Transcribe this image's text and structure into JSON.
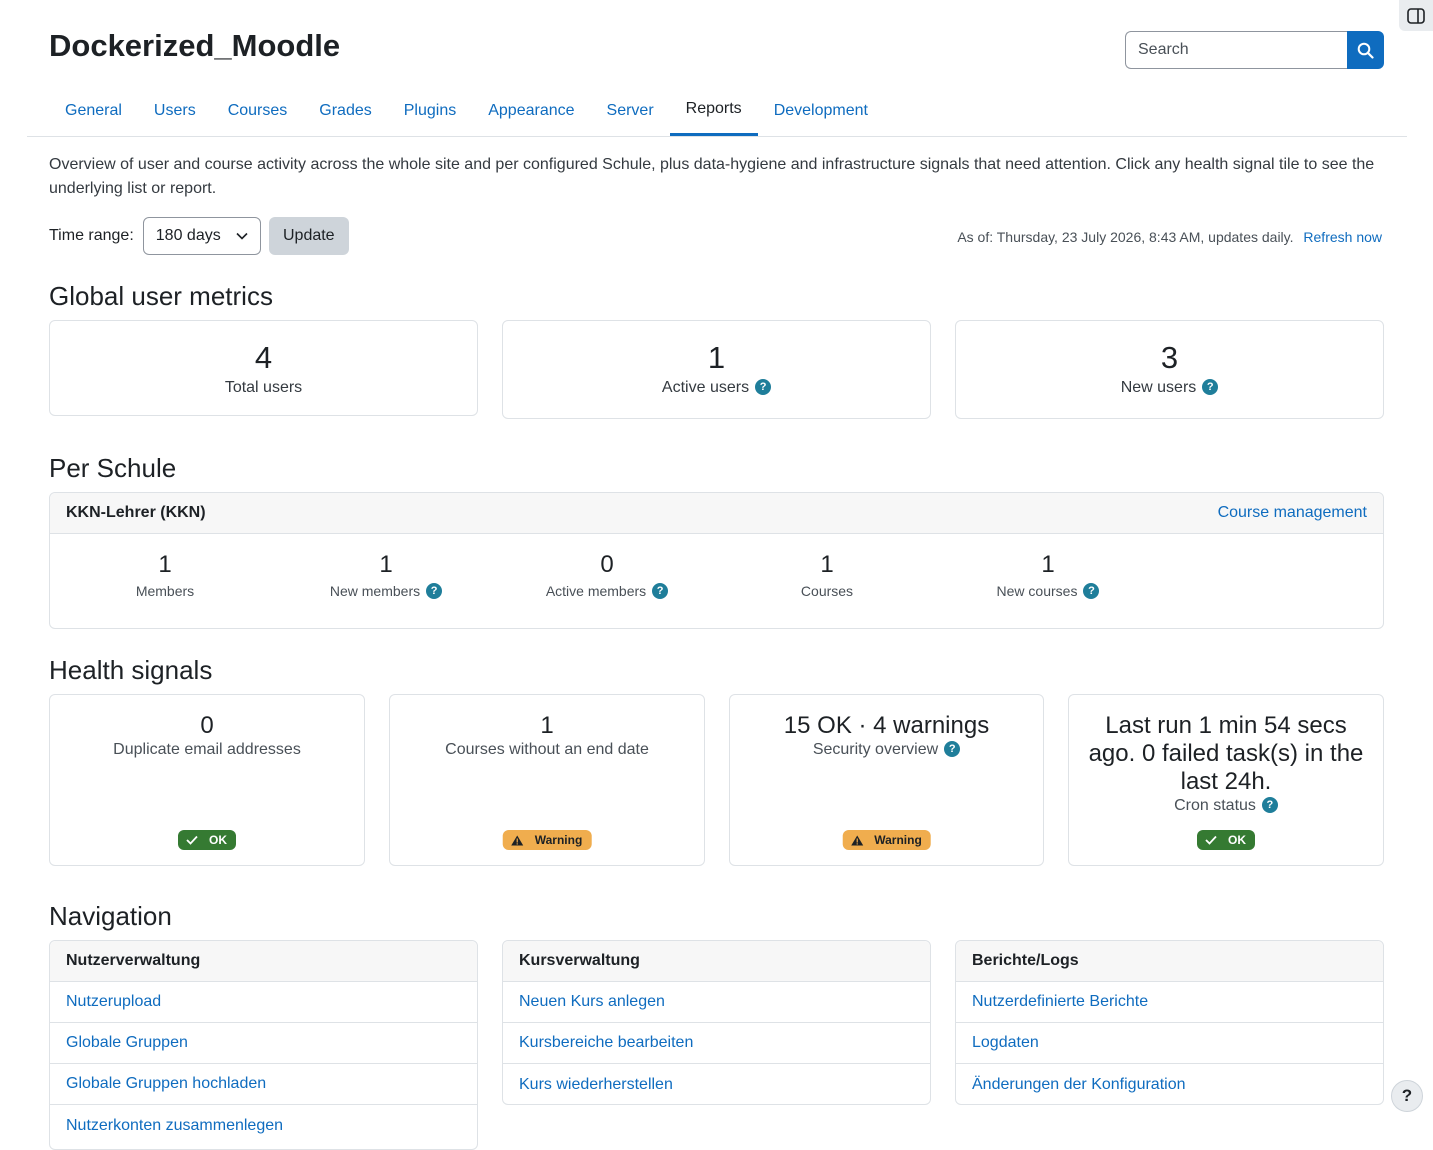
{
  "header": {
    "site_title": "Dockerized_Moodle",
    "search_placeholder": "Search"
  },
  "tabs": [
    {
      "label": "General",
      "active": false
    },
    {
      "label": "Users",
      "active": false
    },
    {
      "label": "Courses",
      "active": false
    },
    {
      "label": "Grades",
      "active": false
    },
    {
      "label": "Plugins",
      "active": false
    },
    {
      "label": "Appearance",
      "active": false
    },
    {
      "label": "Server",
      "active": false
    },
    {
      "label": "Reports",
      "active": true
    },
    {
      "label": "Development",
      "active": false
    }
  ],
  "intro": "Overview of user and course activity across the whole site and per configured Schule, plus data-hygiene and infrastructure signals that need attention. Click any health signal tile to see the underlying list or report.",
  "controls": {
    "time_range_label": "Time range:",
    "time_range_value": "180 days",
    "update_label": "Update",
    "as_of": "As of: Thursday, 23 July 2026, 8:43 AM, updates daily.",
    "refresh_label": "Refresh now"
  },
  "global": {
    "heading": "Global user metrics",
    "metrics": [
      {
        "value": "4",
        "label": "Total users"
      },
      {
        "value": "1",
        "label": "Active users"
      },
      {
        "value": "3",
        "label": "New users"
      }
    ]
  },
  "schule": {
    "heading": "Per Schule",
    "name": "KKN-Lehrer (KKN)",
    "link": "Course management",
    "stats": [
      {
        "value": "1",
        "label": "Members"
      },
      {
        "value": "1",
        "label": "New members"
      },
      {
        "value": "0",
        "label": "Active members"
      },
      {
        "value": "1",
        "label": "Courses"
      },
      {
        "value": "1",
        "label": "New courses"
      }
    ]
  },
  "health": {
    "heading": "Health signals",
    "signals": [
      {
        "value": "0",
        "label": "Duplicate email addresses",
        "status": "OK"
      },
      {
        "value": "1",
        "label": "Courses without an end date",
        "status": "Warning"
      },
      {
        "value": "15 OK · 4 warnings",
        "label": "Security overview",
        "status": "Warning"
      },
      {
        "value": "Last run 1 min 54 secs ago. 0 failed task(s) in the last 24h.",
        "label": "Cron status",
        "status": "OK"
      }
    ]
  },
  "navigation": {
    "heading": "Navigation",
    "groups": [
      {
        "title": "Nutzerverwaltung",
        "items": [
          "Nutzerupload",
          "Globale Gruppen",
          "Globale Gruppen hochladen",
          "Nutzerkonten zusammenlegen"
        ]
      },
      {
        "title": "Kursverwaltung",
        "items": [
          "Neuen Kurs anlegen",
          "Kursbereiche bearbeiten",
          "Kurs wiederherstellen"
        ]
      },
      {
        "title": "Berichte/Logs",
        "items": [
          "Nutzerdefinierte Berichte",
          "Logdaten",
          "Änderungen der Konfiguration"
        ]
      }
    ]
  },
  "help_button": "?",
  "colors": {
    "accent": "#0f6cbf",
    "ok": "#357a32",
    "warning": "#f0ad4e",
    "help_icon": "#1f7e9a"
  }
}
